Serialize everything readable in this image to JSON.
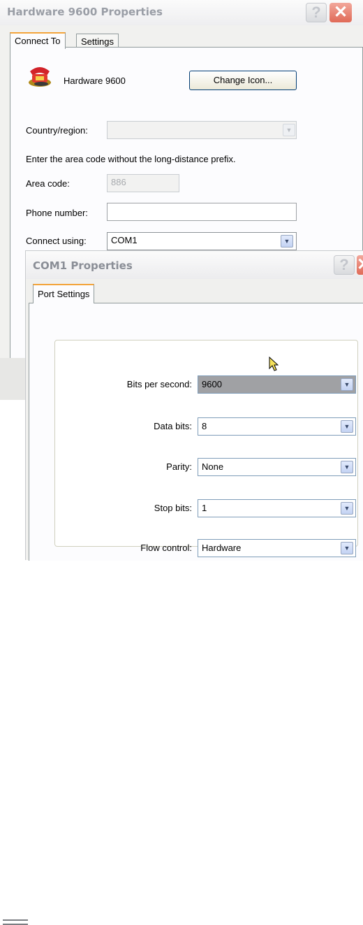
{
  "main_dialog": {
    "title": "Hardware 9600 Properties",
    "help_label": "?",
    "close_label": "✕",
    "tabs": [
      {
        "label": "Connect To",
        "active": true
      },
      {
        "label": "Settings",
        "active": false
      }
    ],
    "connection_icon": "phone-icon",
    "connection_name": "Hardware 9600",
    "change_icon_label": "Change Icon...",
    "country_label": "Country/region:",
    "country_value": "",
    "area_code_note": "Enter the area code without the long-distance prefix.",
    "area_code_label": "Area code:",
    "area_code_value": "886",
    "phone_label": "Phone number:",
    "phone_value": "",
    "connect_using_label": "Connect using:",
    "connect_using_value": "COM1"
  },
  "com_dialog": {
    "title": "COM1 Properties",
    "help_label": "?",
    "close_label": "✕",
    "tabs": [
      {
        "label": "Port Settings",
        "active": true
      }
    ],
    "fields": [
      {
        "label": "Bits per second:",
        "value": "9600"
      },
      {
        "label": "Data bits:",
        "value": "8"
      },
      {
        "label": "Parity:",
        "value": "None"
      },
      {
        "label": "Stop bits:",
        "value": "1"
      },
      {
        "label": "Flow control:",
        "value": "Hardware"
      }
    ]
  },
  "icons": {
    "dropdown_arrow": "chevron-down-icon",
    "cursor": "mouse-pointer-icon"
  },
  "colors": {
    "tab_accent": "#f3a43b",
    "close_red": "#e06a57",
    "selected_field_bg": "#a0a1a4"
  }
}
